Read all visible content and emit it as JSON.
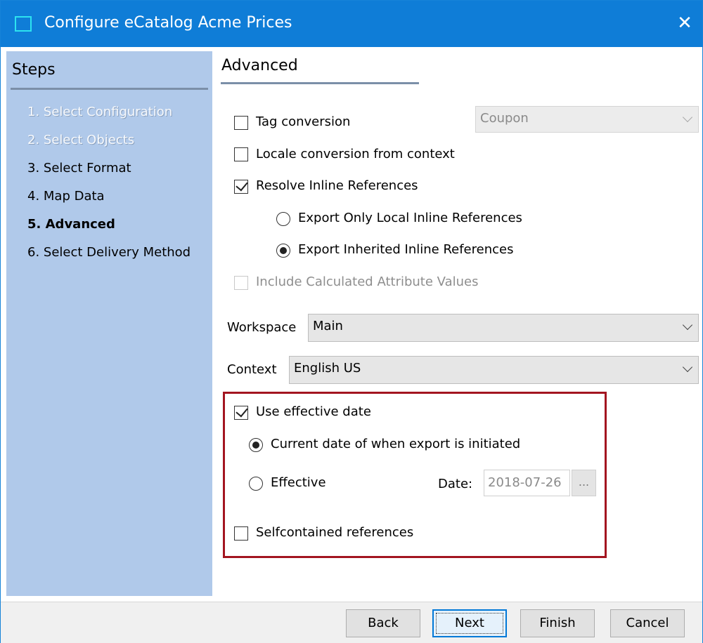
{
  "window": {
    "title": "Configure eCatalog Acme Prices",
    "close_glyph": "✕",
    "app_icon": "window-icon"
  },
  "steps": {
    "title": "Steps",
    "items": [
      {
        "label": "1. Select Configuration",
        "state": "disabled"
      },
      {
        "label": "2. Select Objects",
        "state": "disabled"
      },
      {
        "label": "3. Select Format",
        "state": "normal"
      },
      {
        "label": "4. Map Data",
        "state": "normal"
      },
      {
        "label": "5. Advanced",
        "state": "current"
      },
      {
        "label": "6. Select Delivery Method",
        "state": "normal"
      }
    ]
  },
  "panel": {
    "title": "Advanced",
    "tag_conversion": {
      "label": "Tag conversion",
      "checked": false
    },
    "tag_combo": {
      "value": "Coupon",
      "enabled": false
    },
    "locale_conversion": {
      "label": "Locale conversion from context",
      "checked": false
    },
    "resolve_inline": {
      "label": "Resolve Inline References",
      "checked": true
    },
    "export_local": {
      "label": "Export Only Local Inline References",
      "selected": false
    },
    "export_inherited": {
      "label": "Export Inherited Inline References",
      "selected": true
    },
    "include_calculated": {
      "label": "Include Calculated Attribute Values",
      "checked": false,
      "enabled": false
    },
    "workspace": {
      "label": "Workspace",
      "value": "Main"
    },
    "context": {
      "label": "Context",
      "value": "English US"
    },
    "use_effective_date": {
      "label": "Use effective date",
      "checked": true
    },
    "current_date": {
      "label": "Current date of when export is initiated",
      "selected": true
    },
    "effective": {
      "label": "Effective",
      "selected": false
    },
    "date": {
      "label": "Date:",
      "value": "2018-07-26",
      "browse": "..."
    },
    "selfcontained": {
      "label": "Selfcontained references",
      "checked": false
    }
  },
  "footer": {
    "back": "Back",
    "next": "Next",
    "finish": "Finish",
    "cancel": "Cancel"
  },
  "colors": {
    "titlebar": "#0f7dd7",
    "steps_panel": "#b0c9ea",
    "highlight_border": "#a31520",
    "default_button_border": "#0078d7"
  }
}
